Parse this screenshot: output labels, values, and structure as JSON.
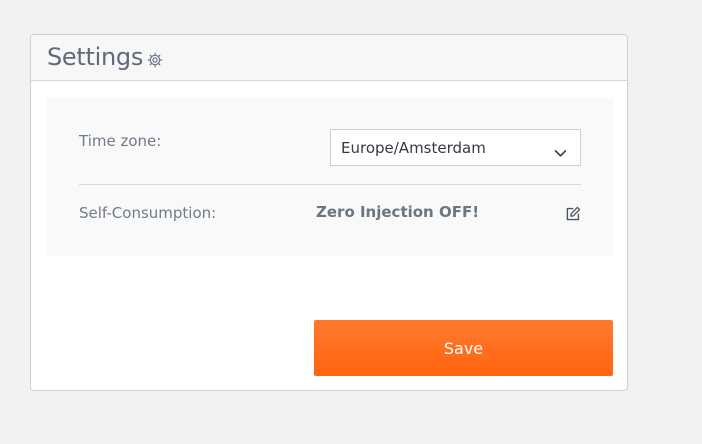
{
  "settings": {
    "title": "Settings",
    "header_icon": "gear-icon",
    "time_zone": {
      "label": "Time zone:",
      "selected": "Europe/Amsterdam"
    },
    "self_consumption": {
      "label": "Self-Consumption:",
      "value": "Zero Injection OFF!",
      "edit_icon": "edit-icon"
    },
    "save_label": "Save"
  },
  "colors": {
    "page_background": "#f3f1f1",
    "card_border": "#cfcfcf",
    "title_text": "#5f6b7c",
    "label_text": "#707b88",
    "value_text": "#6a7585",
    "save_button": "#ff6a1a",
    "save_text": "#ffffff"
  }
}
